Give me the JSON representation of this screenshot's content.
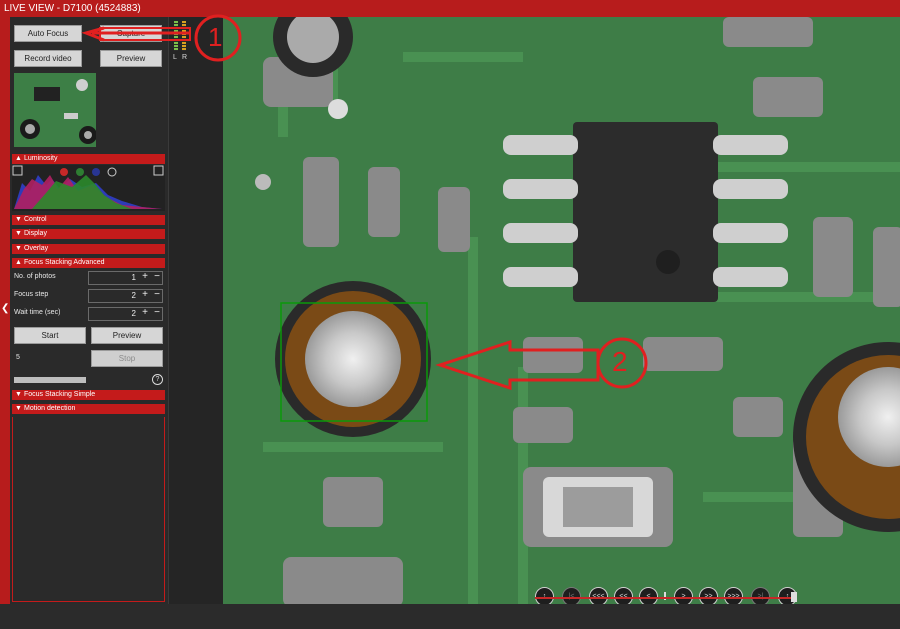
{
  "window": {
    "title": "LIVE VIEW - D7100 (4524883)"
  },
  "toolbar": {
    "auto_focus": "Auto Focus",
    "capture": "Capture",
    "record_video": "Record video",
    "preview": "Preview"
  },
  "meter": {
    "left": "L",
    "right": "R"
  },
  "sections": {
    "luminosity": "Luminosity",
    "control": "Control",
    "display": "Display",
    "overlay": "Overlay",
    "fsa": "Focus Stacking Advanced",
    "fss": "Focus Stacking Simple",
    "motion": "Motion detection"
  },
  "focus_stacking": {
    "photos_label": "No. of photos",
    "photos_value": "1",
    "step_label": "Focus step",
    "step_value": "2",
    "wait_label": "Wait time (sec)",
    "wait_value": "2",
    "start": "Start",
    "preview": "Preview",
    "stop": "Stop",
    "count": "5",
    "help": "?"
  },
  "callouts": {
    "one": "1",
    "two": "2"
  },
  "nav": {
    "items": [
      "↑",
      "|<",
      "<<<",
      "<<",
      "<",
      ">",
      ">>",
      ">>>",
      ">|",
      "↑"
    ]
  }
}
